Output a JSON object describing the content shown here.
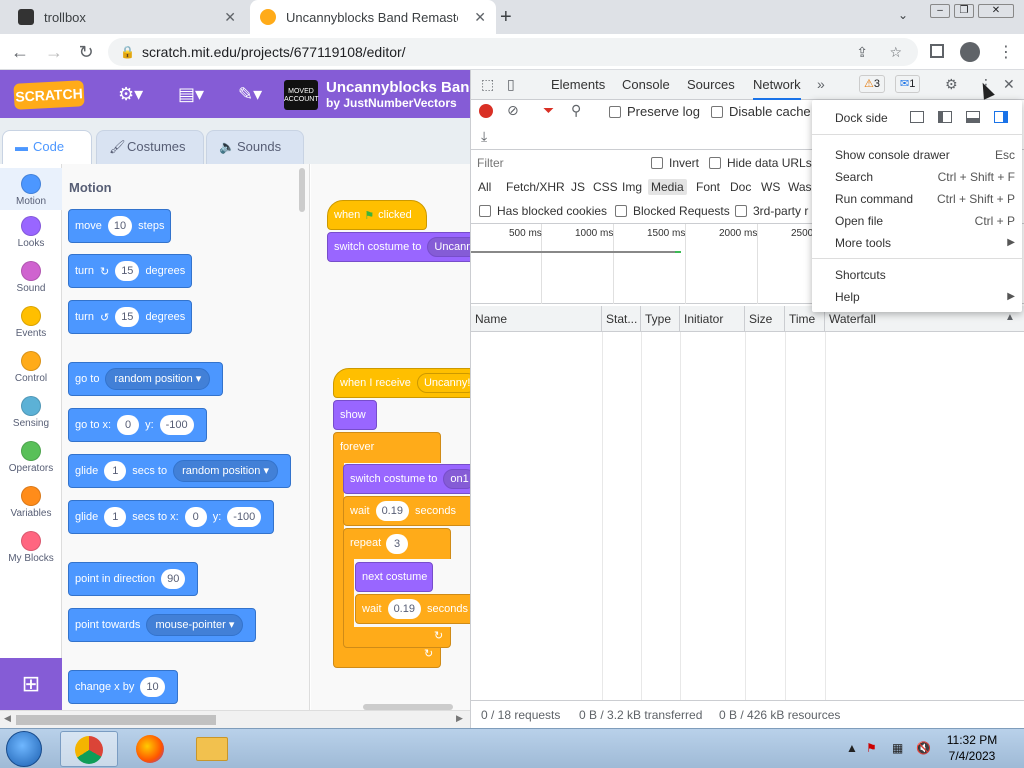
{
  "browser": {
    "tabs": [
      {
        "title": "trollbox"
      },
      {
        "title": "Uncannyblocks Band Remastered"
      }
    ],
    "url": "scratch.mit.edu/projects/677119108/editor/"
  },
  "scratch": {
    "logo": "SCRATCH",
    "thumb_text": "MOVED ACCOUNT",
    "project_title": "Uncannyblocks Band",
    "project_author": "by JustNumberVectors",
    "tabs": {
      "code": "Code",
      "costumes": "Costumes",
      "sounds": "Sounds"
    },
    "categories": [
      {
        "label": "Motion",
        "color": "#4c97ff"
      },
      {
        "label": "Looks",
        "color": "#9966ff"
      },
      {
        "label": "Sound",
        "color": "#cf63cf"
      },
      {
        "label": "Events",
        "color": "#ffbf00"
      },
      {
        "label": "Control",
        "color": "#ffab19"
      },
      {
        "label": "Sensing",
        "color": "#5cb1d6"
      },
      {
        "label": "Operators",
        "color": "#59c059"
      },
      {
        "label": "Variables",
        "color": "#ff8c1a"
      },
      {
        "label": "My Blocks",
        "color": "#ff6680"
      }
    ],
    "palette_title": "Motion",
    "blocks": {
      "move": {
        "a": "move",
        "v": "10",
        "b": "steps"
      },
      "turn_cw": {
        "a": "turn",
        "v": "15",
        "b": "degrees"
      },
      "turn_ccw": {
        "a": "turn",
        "v": "15",
        "b": "degrees"
      },
      "goto": {
        "a": "go to",
        "d": "random position"
      },
      "gotoxy": {
        "a": "go to x:",
        "x": "0",
        "b": "y:",
        "y": "-100"
      },
      "glide": {
        "a": "glide",
        "v": "1",
        "b": "secs to",
        "d": "random position"
      },
      "glidexy": {
        "a": "glide",
        "v": "1",
        "b": "secs to x:",
        "x": "0",
        "c": "y:",
        "y": "-100"
      },
      "point_dir": {
        "a": "point in direction",
        "v": "90"
      },
      "point_towards": {
        "a": "point towards",
        "d": "mouse-pointer"
      },
      "change_x": {
        "a": "change x by",
        "v": "10"
      }
    },
    "script": {
      "when_flag": "when",
      "clicked": "clicked",
      "switch1": "switch costume to",
      "switch1_val": "Uncann",
      "when_receive": "when I receive",
      "receive_val": "Uncanny!",
      "show": "show",
      "forever": "forever",
      "switch2": "switch costume to",
      "switch2_val": "on1",
      "wait1": "wait",
      "wait1_val": "0.19",
      "seconds1": "seconds",
      "repeat": "repeat",
      "repeat_val": "3",
      "next_costume": "next costume",
      "wait2": "wait",
      "wait2_val": "0.19",
      "seconds2": "seconds"
    }
  },
  "devtools": {
    "tabs": [
      "Elements",
      "Console",
      "Sources",
      "Network"
    ],
    "warnings": "3",
    "messages": "1",
    "preserve_log": "Preserve log",
    "disable_cache": "Disable cache",
    "filter_placeholder": "Filter",
    "invert": "Invert",
    "hide_data_urls": "Hide data URLs",
    "types": [
      "All",
      "Fetch/XHR",
      "JS",
      "CSS",
      "Img",
      "Media",
      "Font",
      "Doc",
      "WS",
      "Was"
    ],
    "has_blocked": "Has blocked cookies",
    "blocked_requests": "Blocked Requests",
    "third_party": "3rd-party r",
    "ticks": [
      "500 ms",
      "1000 ms",
      "1500 ms",
      "2000 ms",
      "2500"
    ],
    "columns": [
      "Name",
      "Stat...",
      "Type",
      "Initiator",
      "Size",
      "Time",
      "Waterfall"
    ],
    "status": {
      "requests": "0 / 18 requests",
      "transferred": "0 B / 3.2 kB transferred",
      "resources": "0 B / 426 kB resources"
    }
  },
  "menu": {
    "dock_side": "Dock side",
    "items": [
      {
        "label": "Show console drawer",
        "shortcut": "Esc"
      },
      {
        "label": "Search",
        "shortcut": "Ctrl + Shift + F"
      },
      {
        "label": "Run command",
        "shortcut": "Ctrl + Shift + P"
      },
      {
        "label": "Open file",
        "shortcut": "Ctrl + P"
      },
      {
        "label": "More tools",
        "shortcut": ""
      }
    ],
    "items2": [
      {
        "label": "Shortcuts"
      },
      {
        "label": "Help"
      }
    ]
  },
  "taskbar": {
    "time": "11:32 PM",
    "date": "7/4/2023"
  }
}
